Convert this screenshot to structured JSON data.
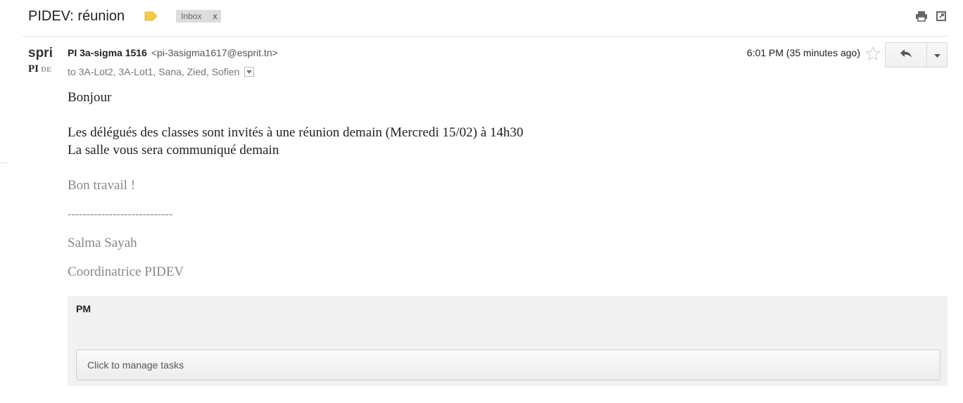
{
  "message": {
    "subject": "PIDEV: réunion",
    "label_chip": {
      "label": "Inbox",
      "remove": "x"
    },
    "label_color": "#f4cc43"
  },
  "toolbar": {
    "print_icon": "print-icon",
    "new_window_icon": "new-window-icon"
  },
  "sender": {
    "avatar_text_top": "spri",
    "avatar_text_bottom_a": "PI",
    "avatar_text_bottom_b": "DE",
    "name": "PI 3a-sigma 1516",
    "email": "<pi-3asigma1617@esprit.tn>",
    "recipients": "to 3A-Lot2, 3A-Lot1, Sana, Zied, Sofien"
  },
  "meta": {
    "time": "6:01 PM (35 minutes ago)"
  },
  "body": {
    "greeting": "Bonjour",
    "line1": "Les délégués des classes sont invités à une réunion demain (Mercredi 15/02) à 14h30",
    "line2": "La salle vous sera communiqué demain",
    "closing": "Bon travail !",
    "separator": "----------------------------",
    "signature_name": "Salma Sayah",
    "signature_title": "Coordinatrice PIDEV"
  },
  "tasks": {
    "title": "PM",
    "prompt": "Click to manage tasks"
  }
}
